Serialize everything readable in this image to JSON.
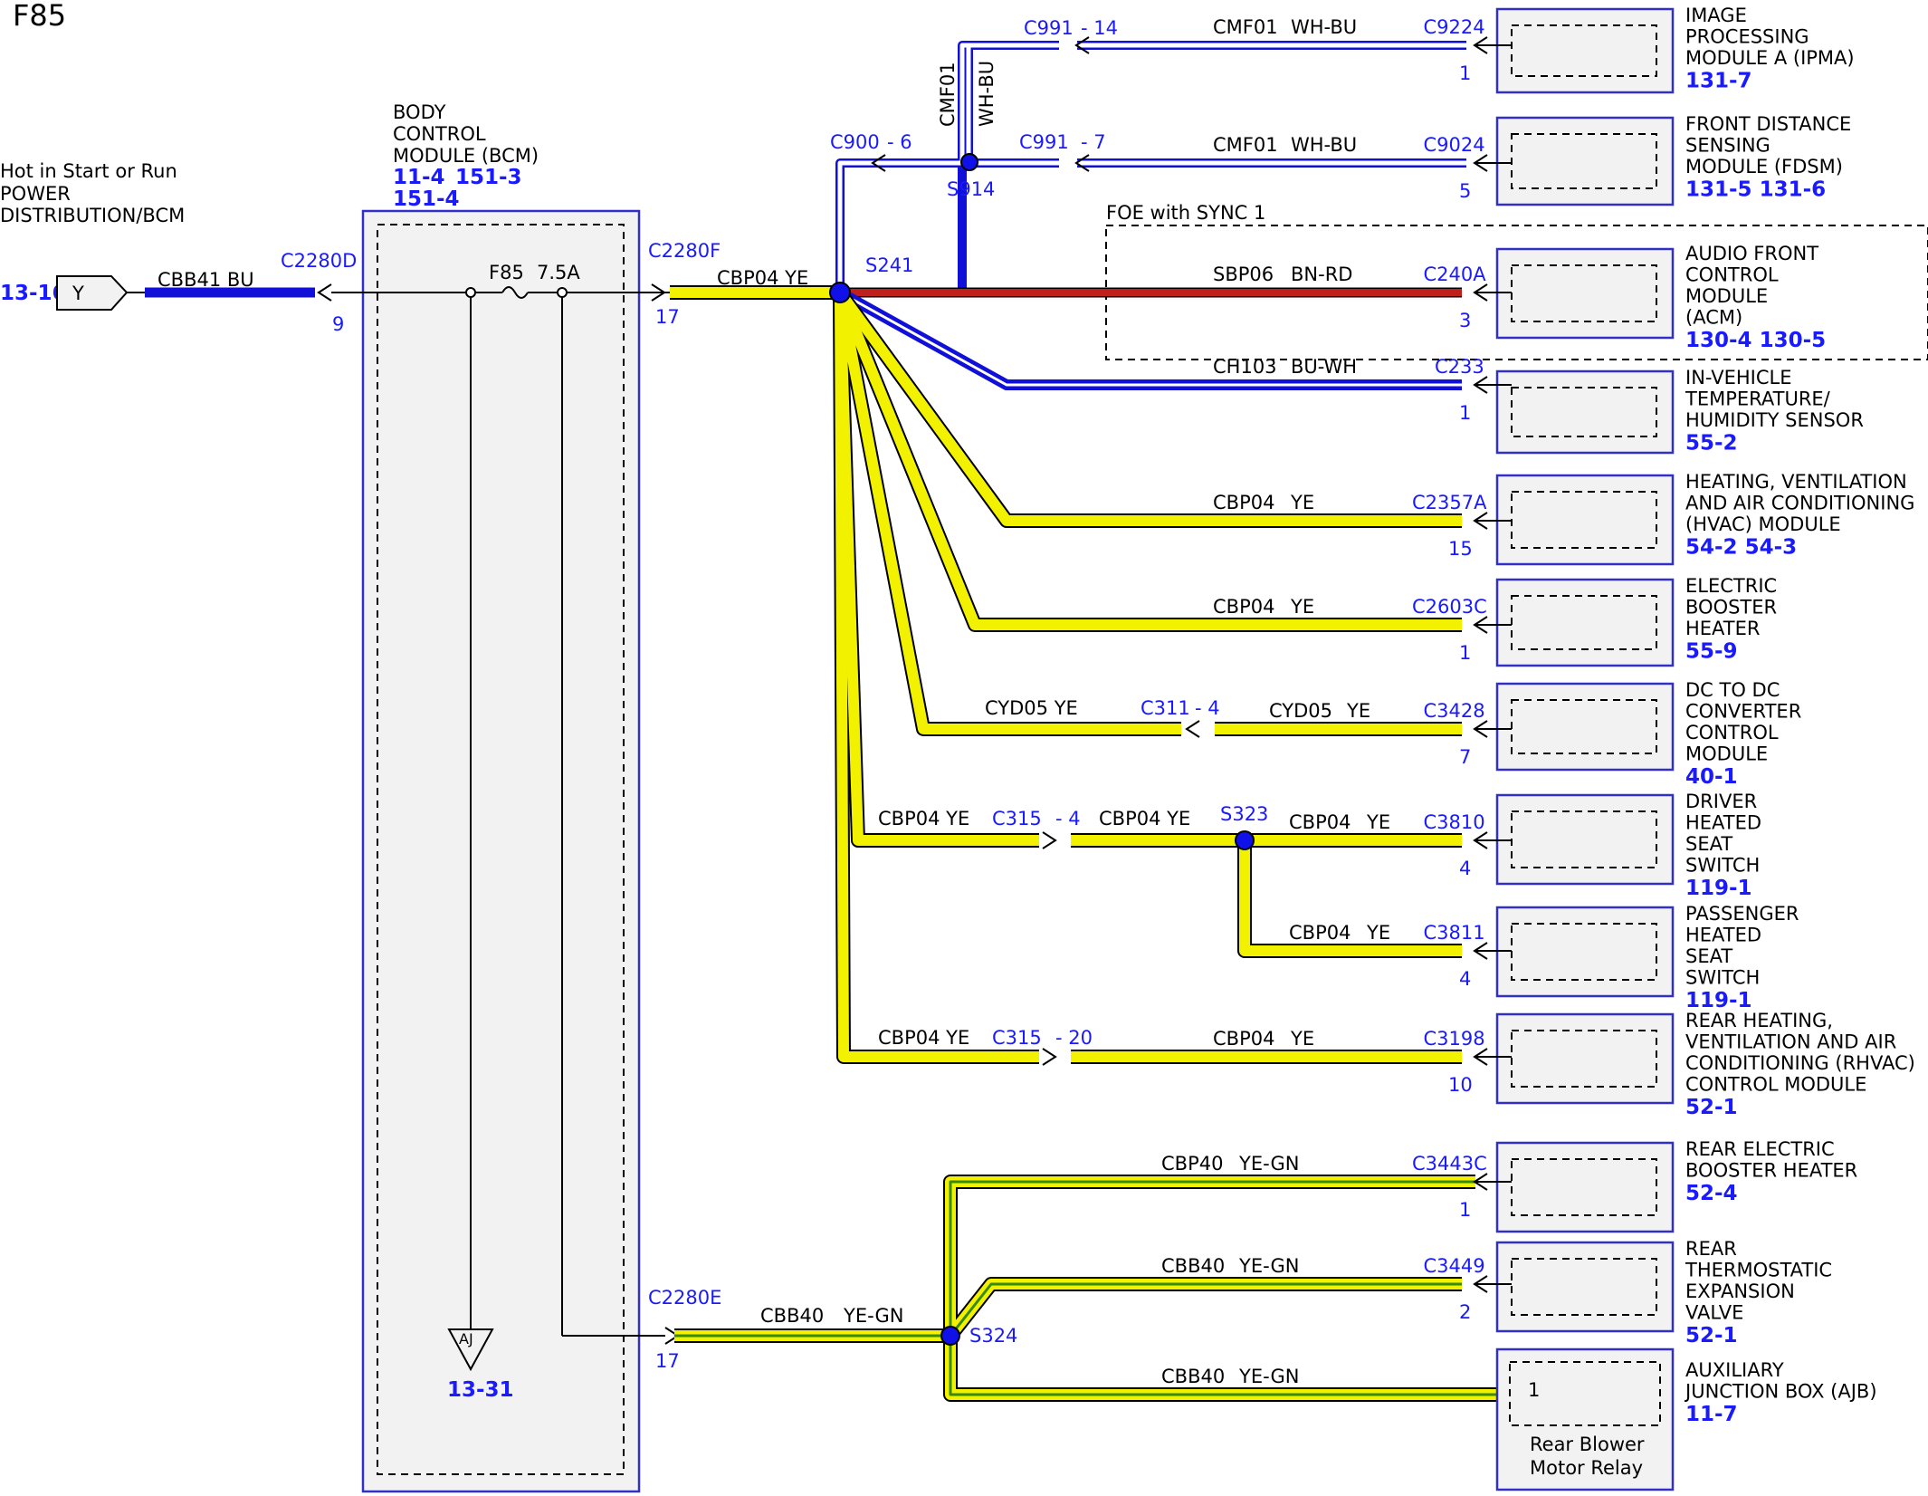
{
  "title": "F85",
  "power_source": {
    "line1": "Hot in Start or Run",
    "line2": "POWER",
    "line3": "DISTRIBUTION/BCM",
    "ref": "13-16",
    "connector_letter": "Y"
  },
  "bcm": {
    "line1": "BODY",
    "line2": "CONTROL",
    "line3": "MODULE (BCM)",
    "ref_a": "11-4",
    "ref_b": "151-3",
    "ref_c": "151-4",
    "fuse_label": "F85",
    "fuse_rating": "7.5A",
    "ground_letter": "AJ",
    "ground_ref": "13-31"
  },
  "input": {
    "connector": "C2280D",
    "pin": "9",
    "wire": "CBB41 BU"
  },
  "out_f": {
    "connector": "C2280F",
    "pin": "17",
    "wire": "CBP04 YE",
    "splice": "S241"
  },
  "out_e": {
    "connector": "C2280E",
    "pin": "17",
    "wire": "CBB40",
    "wire_color": "YE-GN",
    "splice": "S324"
  },
  "upper": {
    "c900": "C900",
    "c900_pin": "- 6",
    "c991a": "C991",
    "c991a_pin": "- 14",
    "c991b": "C991",
    "c991b_pin": "- 7",
    "splice": "S914",
    "vert_wire1": "CMF01",
    "vert_wire2": "WH-BU"
  },
  "foe_label": "FOE with SYNC 1",
  "branches": [
    {
      "wire": "CMF01",
      "color": "WH-BU",
      "connector": "C9224",
      "pin": "1",
      "name": [
        "IMAGE",
        "PROCESSING",
        "MODULE A (IPMA)"
      ],
      "ref": "131-7"
    },
    {
      "wire": "CMF01",
      "color": "WH-BU",
      "connector": "C9024",
      "pin": "5",
      "name": [
        "FRONT DISTANCE",
        "SENSING",
        "MODULE (FDSM)"
      ],
      "ref": "131-5 131-6"
    },
    {
      "wire": "SBP06",
      "color": "BN-RD",
      "connector": "C240A",
      "pin": "3",
      "name": [
        "AUDIO FRONT",
        "CONTROL",
        "MODULE",
        "(ACM)"
      ],
      "ref": "130-4 130-5"
    },
    {
      "wire": "CH103",
      "color": "BU-WH",
      "connector": "C233",
      "pin": "1",
      "name": [
        "IN-VEHICLE",
        "TEMPERATURE/",
        "HUMIDITY SENSOR"
      ],
      "ref": "55-2"
    },
    {
      "wire": "CBP04",
      "color": "YE",
      "connector": "C2357A",
      "pin": "15",
      "name": [
        "HEATING, VENTILATION",
        "AND AIR CONDITIONING",
        "(HVAC) MODULE"
      ],
      "ref": "54-2  54-3"
    },
    {
      "wire": "CBP04",
      "color": "YE",
      "connector": "C2603C",
      "pin": "1",
      "name": [
        "ELECTRIC",
        "BOOSTER",
        "HEATER"
      ],
      "ref": "55-9"
    },
    {
      "wire": "CYD05",
      "color": "YE",
      "connector": "C3428",
      "pin": "7",
      "name": [
        "DC TO DC",
        "CONVERTER",
        "CONTROL",
        "MODULE"
      ],
      "ref": "40-1"
    },
    {
      "wire": "CBP04",
      "color": "YE",
      "connector": "C3810",
      "pin": "4",
      "name": [
        "DRIVER",
        "HEATED",
        "SEAT",
        "SWITCH"
      ],
      "ref": "119-1"
    },
    {
      "wire": "CBP04",
      "color": "YE",
      "connector": "C3811",
      "pin": "4",
      "name": [
        "PASSENGER",
        "HEATED",
        "SEAT",
        "SWITCH"
      ],
      "ref": "119-1"
    },
    {
      "wire": "CBP04",
      "color": "YE",
      "connector": "C3198",
      "pin": "10",
      "name": [
        "REAR HEATING,",
        "VENTILATION AND AIR",
        "CONDITIONING (RHVAC)",
        "CONTROL MODULE"
      ],
      "ref": "52-1"
    },
    {
      "wire": "CBP40",
      "color": "YE-GN",
      "connector": "C3443C",
      "pin": "1",
      "name": [
        "REAR ELECTRIC",
        "BOOSTER HEATER"
      ],
      "ref": "52-4"
    },
    {
      "wire": "CBB40",
      "color": "YE-GN",
      "connector": "C3449",
      "pin": "2",
      "name": [
        "REAR",
        "THERMOSTATIC",
        "EXPANSION",
        "VALVE"
      ],
      "ref": "52-1"
    },
    {
      "wire": "CBB40",
      "color": "YE-GN",
      "connector": "",
      "pin": "1",
      "name": [
        "AUXILIARY",
        "JUNCTION BOX (AJB)"
      ],
      "ref": "11-7",
      "inner": [
        "Rear Blower",
        "Motor Relay"
      ]
    }
  ],
  "inline": {
    "c311": "C311",
    "c311_pin": "- 4",
    "cyd_left": "CYD05  YE",
    "c315a": "C315",
    "c315a_pin": "- 4",
    "cbp_left_a": "CBP04  YE",
    "cbp_mid_a": "CBP04  YE",
    "s323": "S323",
    "c315b": "C315",
    "c315b_pin": "- 20",
    "cbp_left_b": "CBP04  YE"
  },
  "colors": {
    "blue": "#1010d8",
    "yellow": "#f2f200",
    "red": "#c0201c",
    "green": "#3a8a00",
    "box": "#f2f2f2"
  }
}
